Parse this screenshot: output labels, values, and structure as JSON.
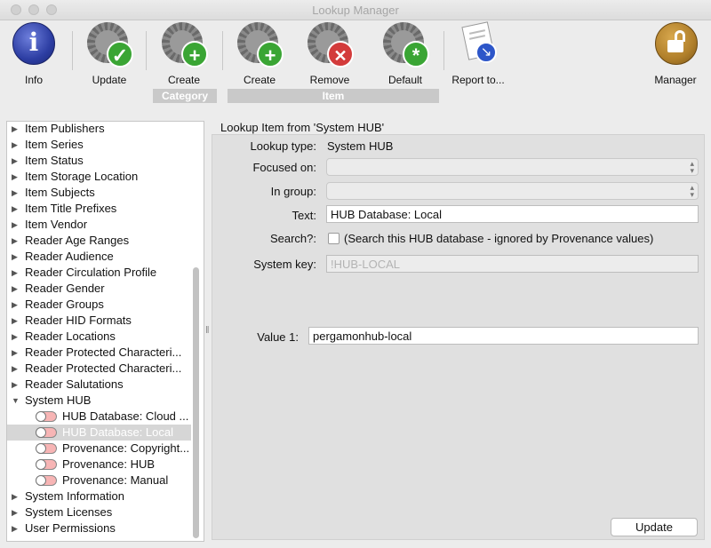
{
  "window": {
    "title": "Lookup Manager"
  },
  "toolbar": {
    "info_label": "Info",
    "update_label": "Update",
    "create_category_label": "Create",
    "create_item_label": "Create",
    "remove_label": "Remove",
    "default_label": "Default",
    "report_label": "Report to...",
    "manager_label": "Manager",
    "group_category": "Category",
    "group_item": "Item"
  },
  "tree": {
    "items": [
      "Item Publishers",
      "Item Series",
      "Item Status",
      "Item Storage Location",
      "Item Subjects",
      "Item Title Prefixes",
      "Item Vendor",
      "Reader Age Ranges",
      "Reader Audience",
      "Reader Circulation Profile",
      "Reader Gender",
      "Reader Groups",
      "Reader HID Formats",
      "Reader Locations",
      "Reader Protected Characteri...",
      "Reader Protected Characteri...",
      "Reader Salutations"
    ],
    "expanded": "System HUB",
    "children": [
      "HUB Database: Cloud ...",
      "HUB Database: Local",
      "Provenance: Copyright...",
      "Provenance: HUB",
      "Provenance: Manual"
    ],
    "selected_child": 1,
    "after": [
      "System Information",
      "System Licenses",
      "User Permissions"
    ]
  },
  "detail": {
    "heading": "Lookup Item from 'System HUB'",
    "lookup_type_label": "Lookup type:",
    "lookup_type_value": "System HUB",
    "focused_on_label": "Focused on:",
    "in_group_label": "In group:",
    "text_label": "Text:",
    "text_value": "HUB Database: Local",
    "search_label": "Search?:",
    "search_hint": "(Search this HUB database - ignored by Provenance values)",
    "system_key_label": "System key:",
    "system_key_value": "!HUB-LOCAL",
    "value1_label": "Value 1:",
    "value1_value": "pergamonhub-local",
    "update_button": "Update"
  },
  "colors": {
    "info_blue": "#2d3ea3",
    "green_badge": "#3aa534",
    "red_badge": "#d33b3b",
    "manager_gold": "#b07f2a"
  }
}
